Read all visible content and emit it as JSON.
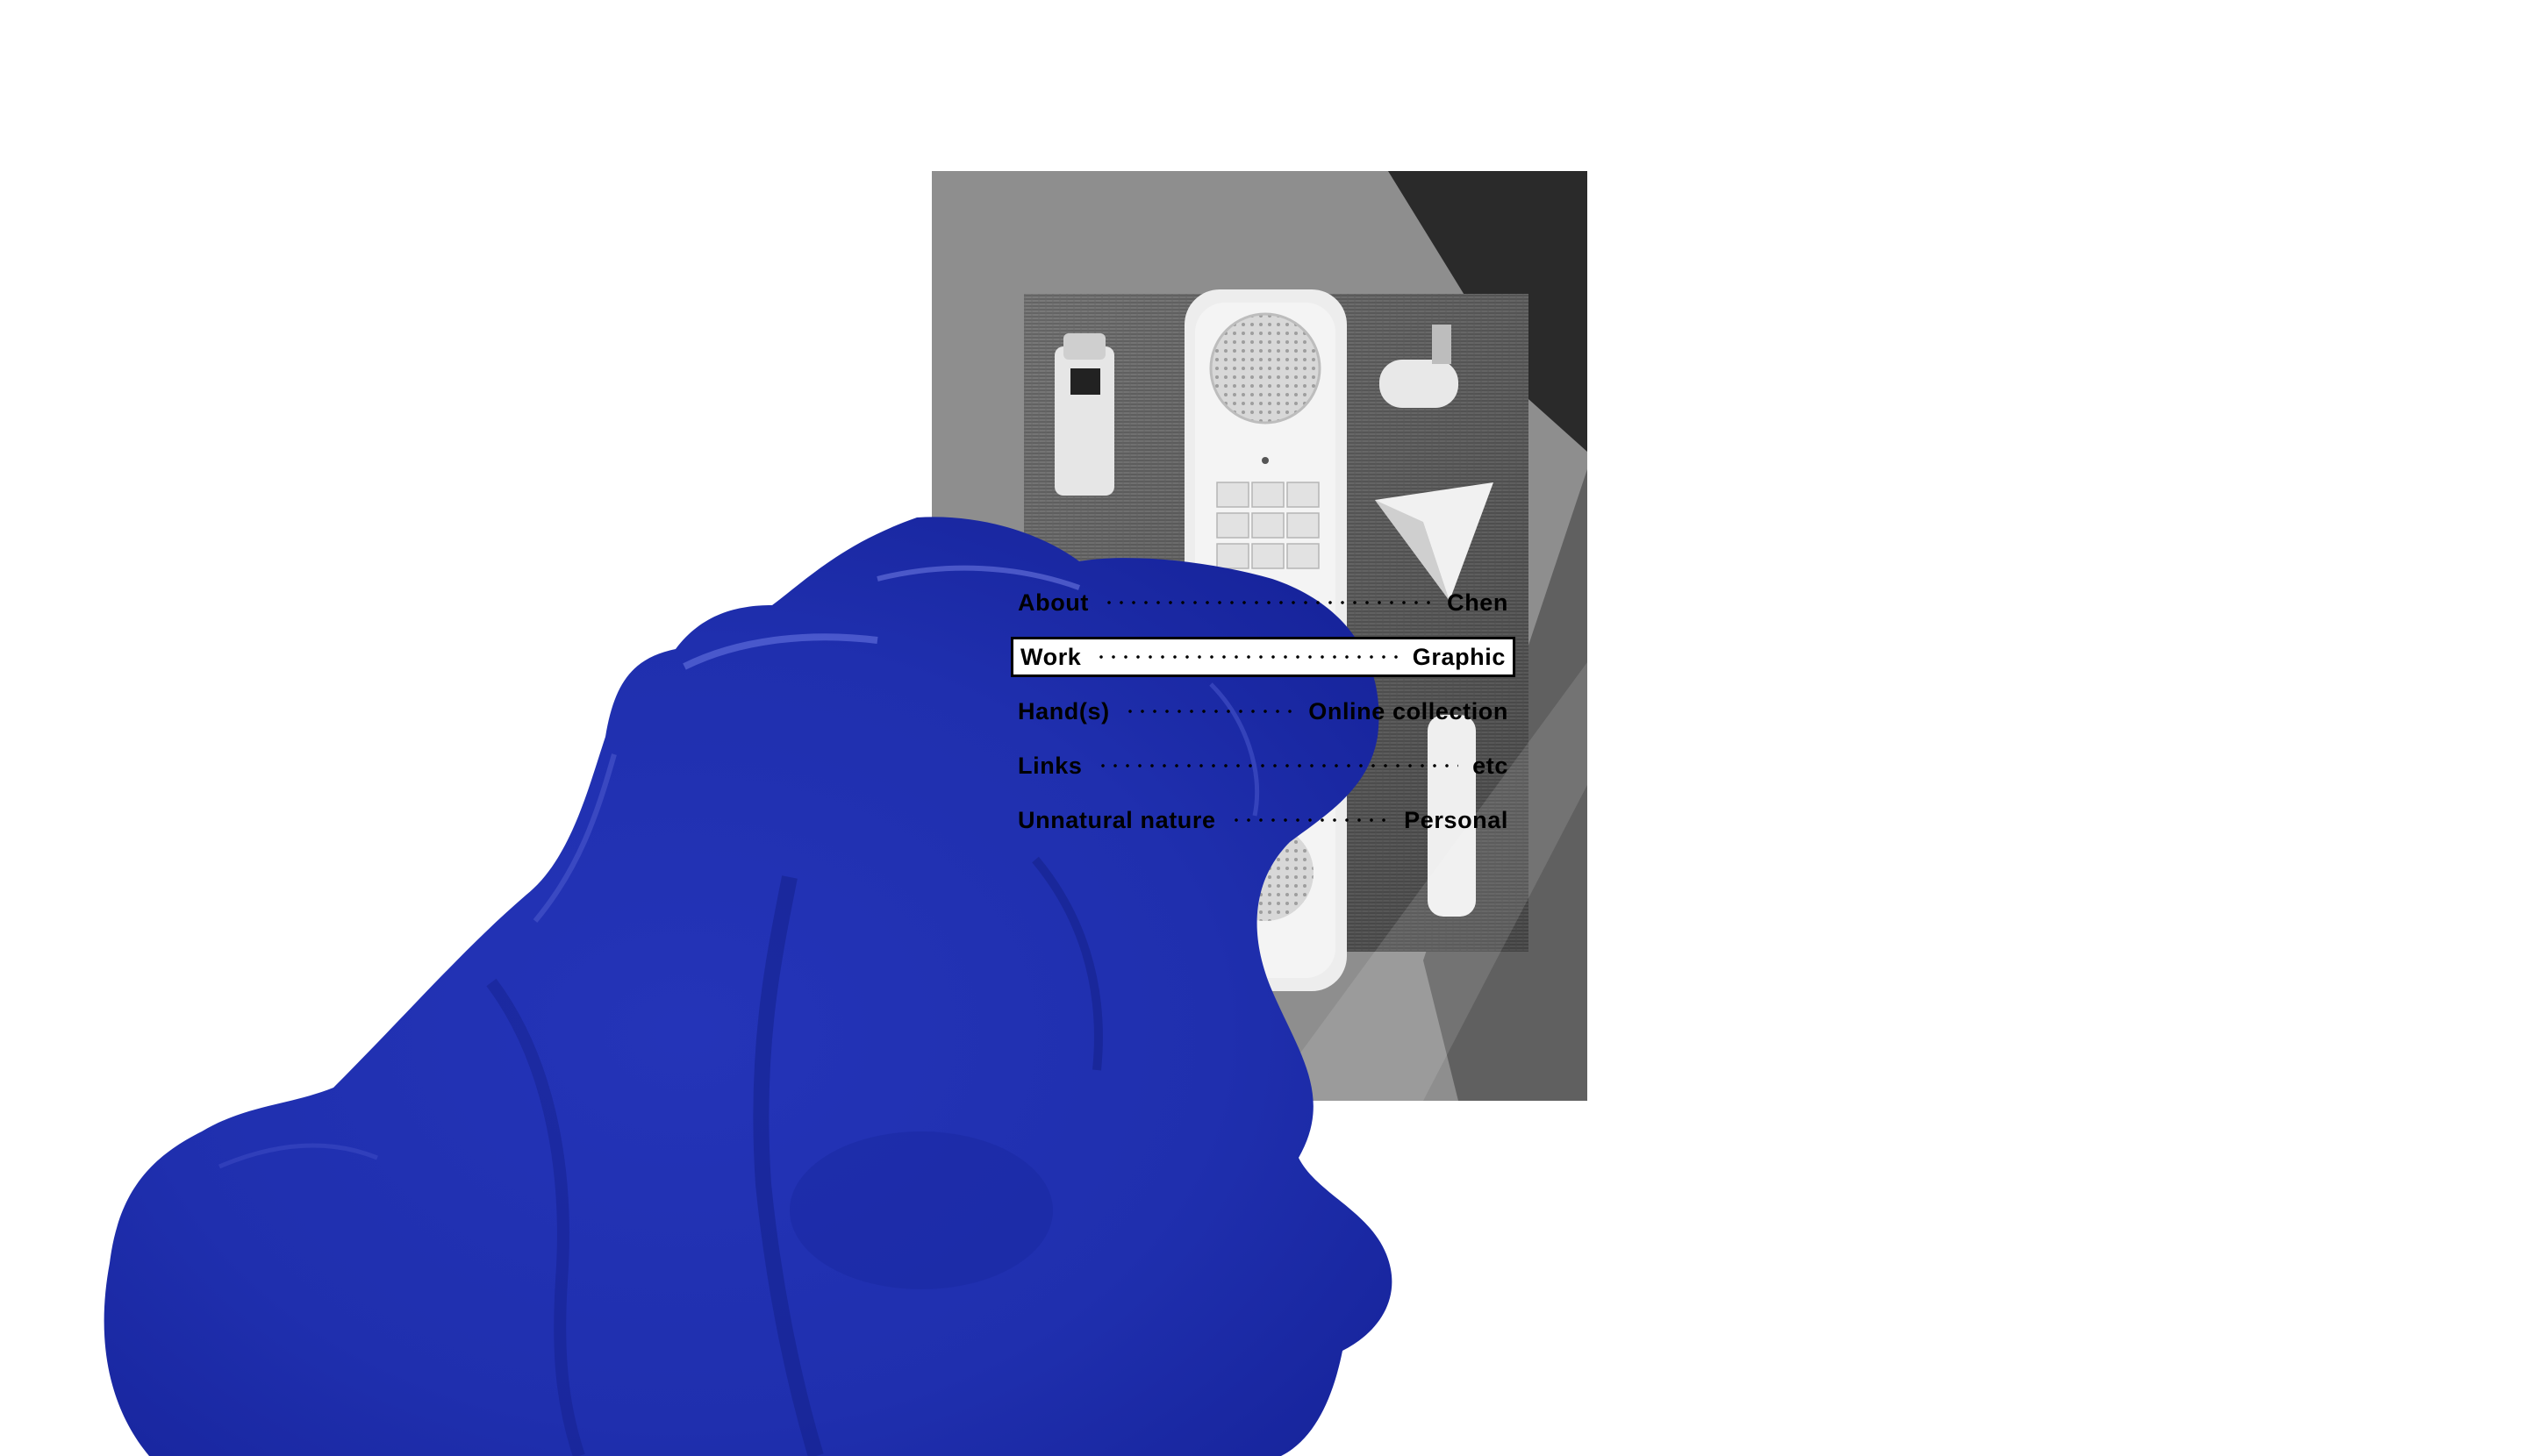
{
  "menu": {
    "items": [
      {
        "label": "About",
        "sub": "Chen",
        "active": false
      },
      {
        "label": "Work",
        "sub": "Graphic",
        "active": true
      },
      {
        "label": "Hand(s)",
        "sub": "Online collection",
        "active": false
      },
      {
        "label": "Links",
        "sub": "etc",
        "active": false
      },
      {
        "label": "Unnatural nature",
        "sub": "Personal",
        "active": false
      }
    ]
  },
  "photo": {
    "subject": "grayscale still life: lighter, telephone handset, paper plane, engraving"
  },
  "paint": {
    "color": "#1f2fae"
  },
  "colors": {
    "background": "#ffffff",
    "text": "#000000",
    "accent": "#1f2fae"
  }
}
